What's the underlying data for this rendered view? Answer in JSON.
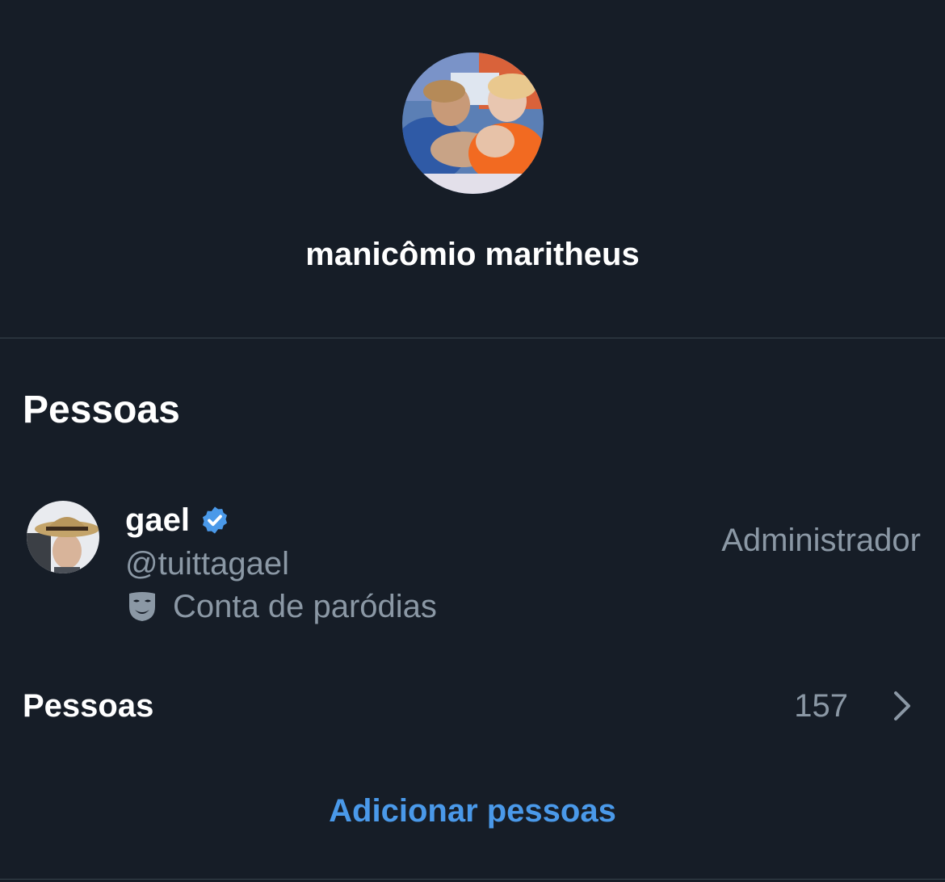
{
  "group": {
    "name": "manicômio maritheus",
    "avatar": "group-photo"
  },
  "people_section": {
    "title": "Pessoas",
    "members": [
      {
        "name": "gael",
        "verified": true,
        "handle": "@tuittagael",
        "label_icon": "parody-mask-icon",
        "label": "Conta de paródias",
        "role": "Administrador"
      }
    ]
  },
  "people_row": {
    "label": "Pessoas",
    "count": "157",
    "icon": "chevron-right-icon"
  },
  "add_people": {
    "label": "Adicionar pessoas"
  },
  "colors": {
    "background": "#161d27",
    "primary_text": "#ffffff",
    "secondary_text": "#8b98a5",
    "accent": "#4a99e9",
    "divider": "#38444d"
  }
}
